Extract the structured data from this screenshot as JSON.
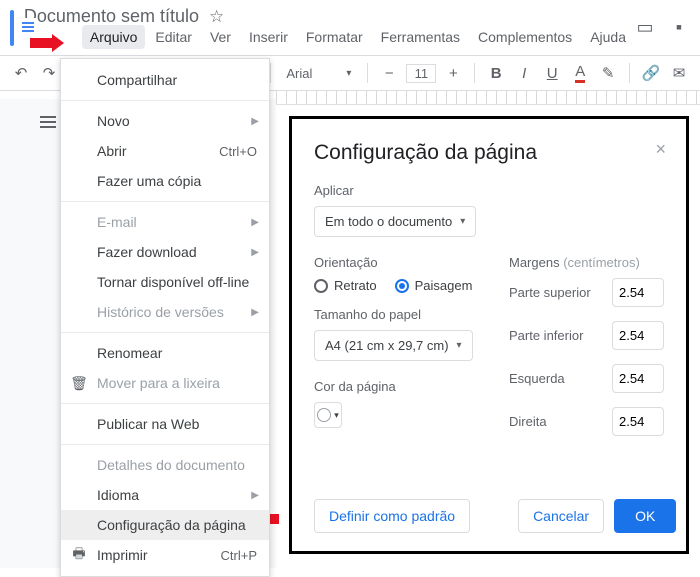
{
  "doc": {
    "title": "Documento sem título"
  },
  "menubar": [
    "Arquivo",
    "Editar",
    "Ver",
    "Inserir",
    "Formatar",
    "Ferramentas",
    "Complementos",
    "Ajuda"
  ],
  "toolbar": {
    "font": "Arial",
    "size": "11"
  },
  "dropdown": {
    "share": "Compartilhar",
    "new": "Novo",
    "open": "Abrir",
    "open_shortcut": "Ctrl+O",
    "copy": "Fazer uma cópia",
    "email": "E-mail",
    "download": "Fazer download",
    "offline": "Tornar disponível off-line",
    "versions": "Histórico de versões",
    "rename": "Renomear",
    "trash": "Mover para a lixeira",
    "publish": "Publicar na Web",
    "details": "Detalhes do documento",
    "language": "Idioma",
    "pagesetup": "Configuração da página",
    "print": "Imprimir",
    "print_shortcut": "Ctrl+P"
  },
  "dialog": {
    "title": "Configuração da página",
    "apply_label": "Aplicar",
    "apply_value": "Em todo o documento",
    "orientation_label": "Orientação",
    "portrait": "Retrato",
    "landscape": "Paisagem",
    "paper_label": "Tamanho do papel",
    "paper_value": "A4 (21 cm x 29,7 cm)",
    "color_label": "Cor da página",
    "margins_label": "Margens",
    "margins_unit": "(centímetros)",
    "top": "Parte superior",
    "bottom": "Parte inferior",
    "left": "Esquerda",
    "right": "Direita",
    "m_top": "2.54",
    "m_bottom": "2.54",
    "m_left": "2.54",
    "m_right": "2.54",
    "set_default": "Definir como padrão",
    "cancel": "Cancelar",
    "ok": "OK"
  }
}
